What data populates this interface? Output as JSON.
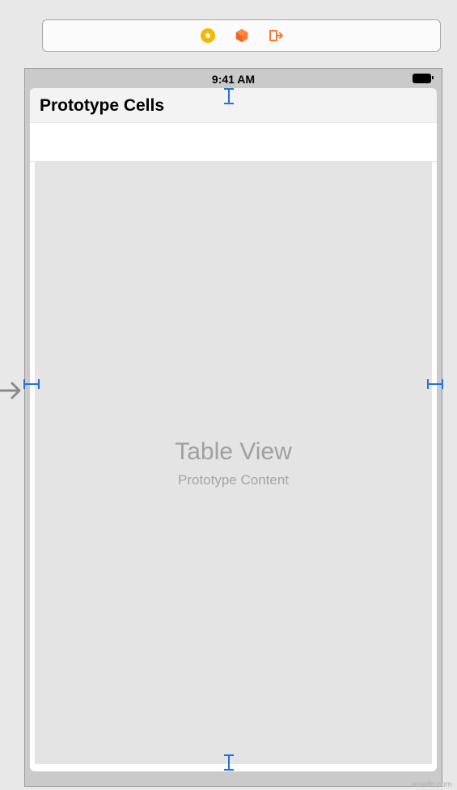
{
  "toolbar": {
    "icons": [
      "circle-icon",
      "cube-icon",
      "exit-icon"
    ]
  },
  "status_bar": {
    "time": "9:41 AM"
  },
  "section": {
    "header": "Prototype Cells"
  },
  "table_view": {
    "title": "Table View",
    "subtitle": "Prototype Content"
  },
  "watermark": "wsxdn.com"
}
